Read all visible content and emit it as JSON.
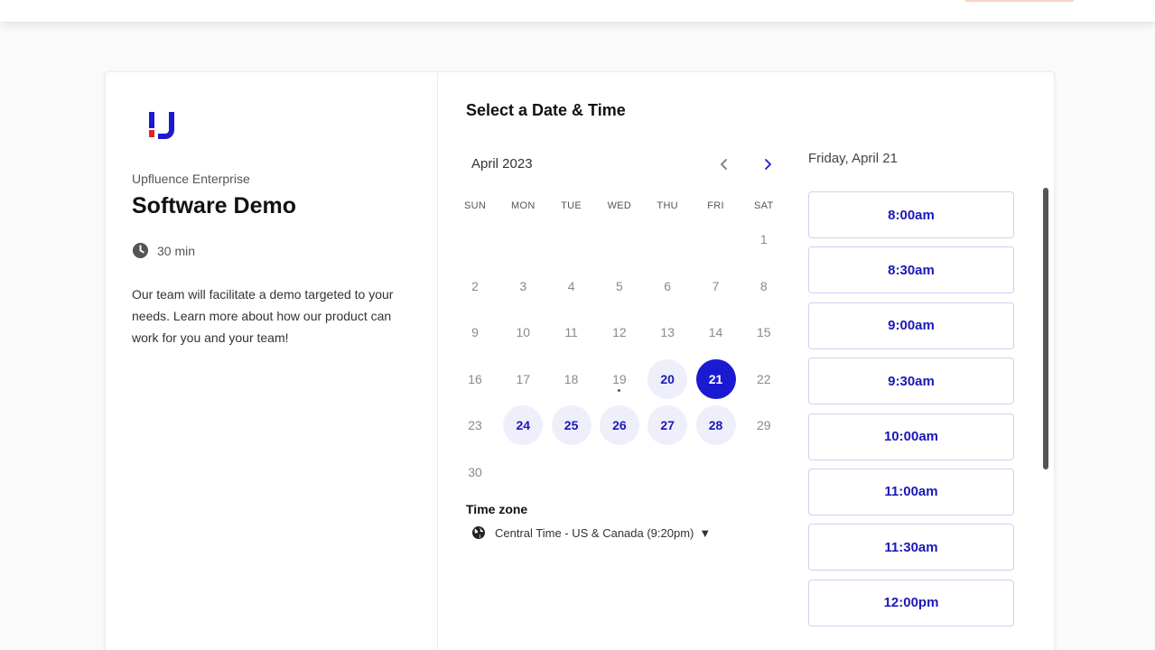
{
  "organizer": {
    "name": "Upfluence Enterprise"
  },
  "event": {
    "title": "Software Demo",
    "duration": "30 min",
    "description": "Our team will facilitate a demo targeted to your needs. Learn more about how our product can work for you and your team!"
  },
  "scheduler": {
    "title": "Select a Date & Time",
    "month": "April 2023",
    "weekdays": [
      "SUN",
      "MON",
      "TUE",
      "WED",
      "THU",
      "FRI",
      "SAT"
    ],
    "days": [
      {
        "label": "1",
        "state": "disabled"
      },
      {
        "label": "2",
        "state": "disabled"
      },
      {
        "label": "3",
        "state": "disabled"
      },
      {
        "label": "4",
        "state": "disabled"
      },
      {
        "label": "5",
        "state": "disabled"
      },
      {
        "label": "6",
        "state": "disabled"
      },
      {
        "label": "7",
        "state": "disabled"
      },
      {
        "label": "8",
        "state": "disabled"
      },
      {
        "label": "9",
        "state": "disabled"
      },
      {
        "label": "10",
        "state": "disabled"
      },
      {
        "label": "11",
        "state": "disabled"
      },
      {
        "label": "12",
        "state": "disabled"
      },
      {
        "label": "13",
        "state": "disabled"
      },
      {
        "label": "14",
        "state": "disabled"
      },
      {
        "label": "15",
        "state": "disabled"
      },
      {
        "label": "16",
        "state": "disabled"
      },
      {
        "label": "17",
        "state": "disabled"
      },
      {
        "label": "18",
        "state": "disabled"
      },
      {
        "label": "19",
        "state": "today"
      },
      {
        "label": "20",
        "state": "available"
      },
      {
        "label": "21",
        "state": "selected"
      },
      {
        "label": "22",
        "state": "disabled"
      },
      {
        "label": "23",
        "state": "disabled"
      },
      {
        "label": "24",
        "state": "available"
      },
      {
        "label": "25",
        "state": "available"
      },
      {
        "label": "26",
        "state": "available"
      },
      {
        "label": "27",
        "state": "available"
      },
      {
        "label": "28",
        "state": "available"
      },
      {
        "label": "29",
        "state": "disabled"
      },
      {
        "label": "30",
        "state": "disabled"
      }
    ],
    "month_start_weekday": 6,
    "timezone_title": "Time zone",
    "timezone_value": "Central Time - US & Canada (9:20pm)",
    "selected_date_label": "Friday, April 21",
    "time_slots": [
      "8:00am",
      "8:30am",
      "9:00am",
      "9:30am",
      "10:00am",
      "11:00am",
      "11:30am",
      "12:00pm"
    ]
  },
  "colors": {
    "brand_primary": "#1a1ad2",
    "brand_accent": "#e0232c",
    "available_bg": "#eeeffb"
  },
  "icons": {
    "logo": "upfluence-logo",
    "duration": "clock-icon",
    "prev": "chevron-left-icon",
    "next": "chevron-right-icon",
    "timezone": "globe-icon"
  }
}
